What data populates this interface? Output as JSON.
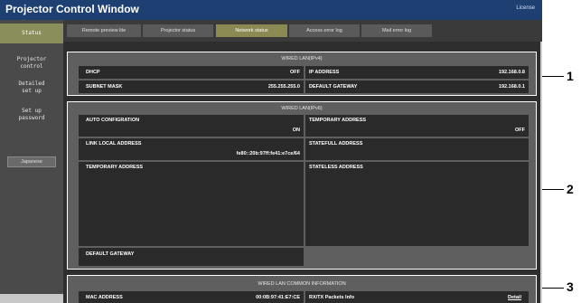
{
  "window": {
    "title": "Projector Control Window",
    "license_link": "License"
  },
  "sidebar": {
    "status": "Status",
    "projector_control": "Projector\ncontrol",
    "detailed_setup": "Detailed\nset up",
    "set_up_password": "Set up\npassword",
    "language": "Japanese"
  },
  "tabs": [
    {
      "label": "Remote preview lite"
    },
    {
      "label": "Projector status"
    },
    {
      "label": "Network status"
    },
    {
      "label": "Access error log"
    },
    {
      "label": "Mail error log"
    }
  ],
  "active_tab": "Network status",
  "ipv4": {
    "title": "WIRED LAN(IPv4)",
    "dhcp_label": "DHCP",
    "dhcp_value": "OFF",
    "ip_label": "IP ADDRESS",
    "ip_value": "192.168.0.8",
    "subnet_label": "SUBNET MASK",
    "subnet_value": "255.255.255.0",
    "gateway_label": "DEFAULT GATEWAY",
    "gateway_value": "192.168.0.1"
  },
  "ipv6": {
    "title": "WIRED LAN(IPv6)",
    "auto_config_label": "AUTO CONFIGRATION",
    "auto_config_value": "ON",
    "temp_addr_right_label": "TEMPORARY ADDRESS",
    "temp_addr_right_value": "OFF",
    "link_local_label": "LINK LOCAL ADDRESS",
    "link_local_value": "fe80::20b:97ff:fe41:e7ce/64",
    "stateful_label": "STATEFULL ADDRESS",
    "temp_addr_left_label": "TEMPORARY ADDRESS",
    "stateless_label": "STATELESS ADDRESS",
    "default_gateway_label": "DEFAULT GATEWAY"
  },
  "common": {
    "title": "WIRED LAN COMMON INFORMATION",
    "mac_label": "MAC ADDRESS",
    "mac_value": "00:0B:97:41:E7:CE",
    "rxtx_label": "RX/TX Packets Info",
    "detail_link": "Detail"
  },
  "callouts": {
    "one": "1",
    "two": "2",
    "three": "3"
  }
}
